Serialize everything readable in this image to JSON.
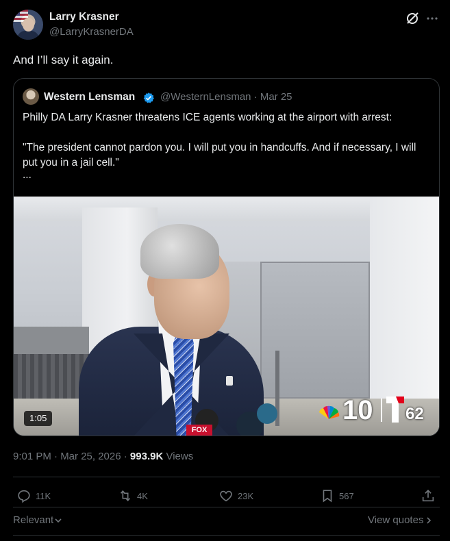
{
  "author": {
    "display_name": "Larry Krasner",
    "handle": "@LarryKrasnerDA"
  },
  "tweet": {
    "text": "And I’ll say it again."
  },
  "quoted_tweet": {
    "display_name": "Western Lensman",
    "handle_date": "@WesternLensman · Mar 25",
    "verified": true,
    "paragraph1": "Philly DA Larry Krasner threatens ICE agents working at the airport with arrest:",
    "paragraph2": "\"The president cannot pardon you. I will put you in handcuffs. And if necessary, I will put you in a jail cell.\"",
    "ellipsis": "...",
    "video": {
      "duration": "1:05",
      "station_logo_1": "10",
      "station_logo_2": "62",
      "mic_badge": "FOX"
    }
  },
  "meta": {
    "time_date": "9:01 PM · Mar 25, 2026 · ",
    "views_count": "993.9K",
    "views_label": " Views"
  },
  "actions": {
    "replies": "11K",
    "reposts": "4K",
    "likes": "23K",
    "bookmarks": "567"
  },
  "footer": {
    "sort_label": "Relevant",
    "view_quotes": "View quotes"
  },
  "colors": {
    "background": "#000000",
    "text_primary": "#e7e9ea",
    "text_secondary": "#71767b",
    "border": "#2f3336",
    "verified_blue": "#1d9bf0"
  },
  "icons": [
    "grok-icon",
    "more-icon",
    "verified-icon",
    "reply-icon",
    "repost-icon",
    "like-icon",
    "bookmark-icon",
    "share-icon",
    "chevron-down-icon",
    "chevron-right-icon"
  ]
}
